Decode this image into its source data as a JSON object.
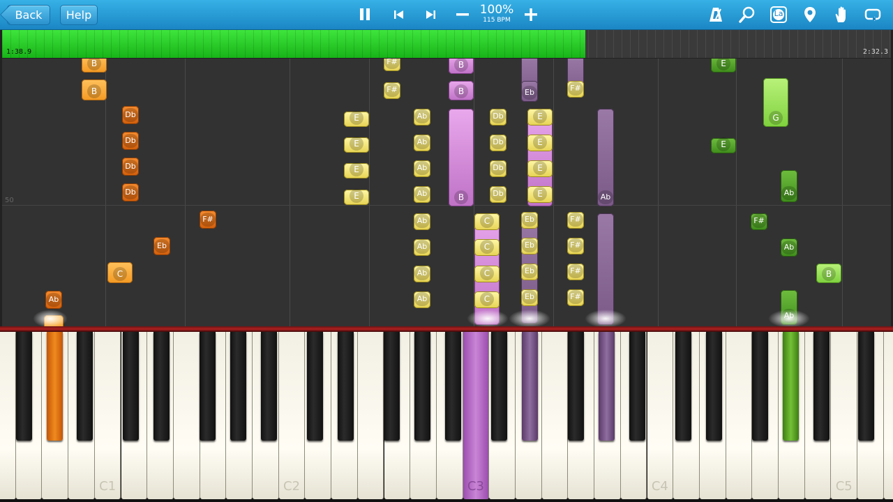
{
  "toolbar": {
    "back_label": "Back",
    "help_label": "Help",
    "speed_percent": "100%",
    "tempo": "115 BPM",
    "icons": [
      "pause-icon",
      "skip-back-icon",
      "skip-forward-icon",
      "minus-icon",
      "plus-icon",
      "metronome-icon",
      "search-icon",
      "note-label-icon",
      "location-pin-icon",
      "hand-icon",
      "loop-icon"
    ],
    "note_label_icon_text": "La"
  },
  "progress": {
    "current_time": "1:38.9",
    "total_time": "2:32.3",
    "fraction": 0.656,
    "color": "#2ecc2e"
  },
  "note_area": {
    "measure_number": "50",
    "notes": {
      "n1": "B",
      "n2": "B",
      "n3": "Db",
      "n4": "Db",
      "n5": "Db",
      "n6": "Db",
      "n7": "F#",
      "n8": "Eb",
      "n9": "C",
      "n10": "Ab",
      "n11": "F#",
      "n12": "F#",
      "n13": "E",
      "n14": "E",
      "n15": "E",
      "n16": "E",
      "n17": "Ab",
      "n18": "Ab",
      "n19": "Ab",
      "n20": "Ab",
      "n21": "Ab",
      "n22": "Ab",
      "n23": "Ab",
      "n24": "Ab",
      "n25": "B",
      "n26": "B",
      "n27": "B",
      "n28": "Db",
      "n29": "Db",
      "n30": "Db",
      "n31": "Db",
      "n32": "C",
      "n33": "C",
      "n34": "C",
      "n35": "C",
      "n36": "Eb",
      "n37": "Eb",
      "n38": "Eb",
      "n39": "Eb",
      "n40": "Eb",
      "n41": "Eb",
      "n42": "E",
      "n43": "E",
      "n44": "E",
      "n45": "E",
      "n46": "F#",
      "n47": "F#",
      "n48": "F#",
      "n49": "F#",
      "n50": "F#",
      "n51": "F#",
      "n52": "Ab",
      "n53": "E",
      "n54": "E",
      "n55": "G",
      "n56": "Ab",
      "n57": "F#",
      "n58": "Ab",
      "n59": "B",
      "n60": "Ab"
    },
    "hand_colors": {
      "left": "#f39a24",
      "right": "#7fd13e",
      "chord": "#c985d6"
    }
  },
  "keyboard": {
    "octave_labels": [
      "C1",
      "C2",
      "C3",
      "C4",
      "C5"
    ]
  }
}
